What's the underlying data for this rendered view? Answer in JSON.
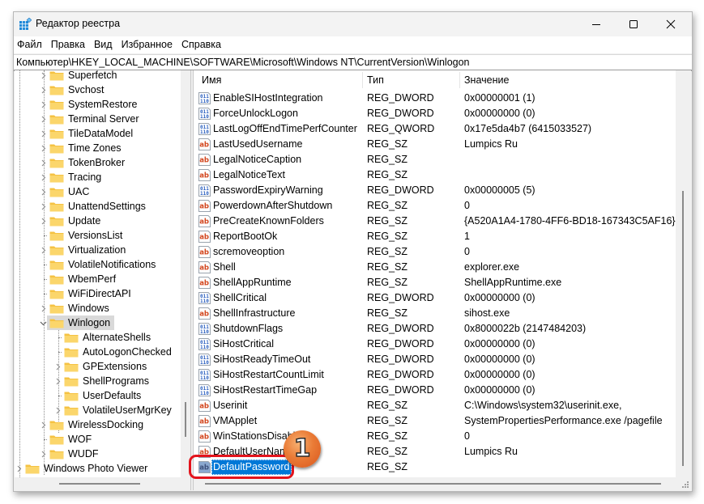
{
  "window": {
    "title": "Редактор реестра",
    "controls": {
      "minimize": "minimize",
      "maximize": "maximize",
      "close": "close"
    }
  },
  "menu": [
    "Файл",
    "Правка",
    "Вид",
    "Избранное",
    "Справка"
  ],
  "address": "Компьютер\\HKEY_LOCAL_MACHINE\\SOFTWARE\\Microsoft\\Windows NT\\CurrentVersion\\Winlogon",
  "tree": {
    "items": [
      {
        "label": "Superfetch",
        "level": 1,
        "expandable": true
      },
      {
        "label": "Svchost",
        "level": 1,
        "expandable": true
      },
      {
        "label": "SystemRestore",
        "level": 1,
        "expandable": true
      },
      {
        "label": "Terminal Server",
        "level": 1,
        "expandable": true
      },
      {
        "label": "TileDataModel",
        "level": 1,
        "expandable": true
      },
      {
        "label": "Time Zones",
        "level": 1,
        "expandable": true
      },
      {
        "label": "TokenBroker",
        "level": 1,
        "expandable": true
      },
      {
        "label": "Tracing",
        "level": 1,
        "expandable": true
      },
      {
        "label": "UAC",
        "level": 1,
        "expandable": true
      },
      {
        "label": "UnattendSettings",
        "level": 1,
        "expandable": true
      },
      {
        "label": "Update",
        "level": 1,
        "expandable": true
      },
      {
        "label": "VersionsList",
        "level": 1,
        "expandable": false
      },
      {
        "label": "Virtualization",
        "level": 1,
        "expandable": true
      },
      {
        "label": "VolatileNotifications",
        "level": 1,
        "expandable": false
      },
      {
        "label": "WbemPerf",
        "level": 1,
        "expandable": false
      },
      {
        "label": "WiFiDirectAPI",
        "level": 1,
        "expandable": false
      },
      {
        "label": "Windows",
        "level": 1,
        "expandable": true
      },
      {
        "label": "Winlogon",
        "level": 1,
        "expandable": true,
        "expanded": true,
        "selected": true
      },
      {
        "label": "AlternateShells",
        "level": 2,
        "expandable": false
      },
      {
        "label": "AutoLogonChecked",
        "level": 2,
        "expandable": false
      },
      {
        "label": "GPExtensions",
        "level": 2,
        "expandable": true
      },
      {
        "label": "ShellPrograms",
        "level": 2,
        "expandable": true
      },
      {
        "label": "UserDefaults",
        "level": 2,
        "expandable": false
      },
      {
        "label": "VolatileUserMgrKey",
        "level": 2,
        "expandable": true
      },
      {
        "label": "WirelessDocking",
        "level": 1,
        "expandable": true
      },
      {
        "label": "WOF",
        "level": 1,
        "expandable": false
      },
      {
        "label": "WUDF",
        "level": 1,
        "expandable": true
      },
      {
        "label": "Windows Photo Viewer",
        "level": 0,
        "expandable": true
      }
    ]
  },
  "list": {
    "columns": {
      "name": "Имя",
      "type": "Тип",
      "value": "Значение"
    },
    "rows": [
      {
        "icon": "binary-value-icon",
        "name": "EnableSIHostIntegration",
        "type": "REG_DWORD",
        "value": "0x00000001 (1)"
      },
      {
        "icon": "binary-value-icon",
        "name": "ForceUnlockLogon",
        "type": "REG_DWORD",
        "value": "0x00000000 (0)"
      },
      {
        "icon": "binary-value-icon",
        "name": "LastLogOffEndTimePerfCounter",
        "type": "REG_QWORD",
        "value": "0x17e5da4b7 (6415033527)"
      },
      {
        "icon": "string-value-icon",
        "name": "LastUsedUsername",
        "type": "REG_SZ",
        "value": "Lumpics Ru"
      },
      {
        "icon": "string-value-icon",
        "name": "LegalNoticeCaption",
        "type": "REG_SZ",
        "value": ""
      },
      {
        "icon": "string-value-icon",
        "name": "LegalNoticeText",
        "type": "REG_SZ",
        "value": ""
      },
      {
        "icon": "binary-value-icon",
        "name": "PasswordExpiryWarning",
        "type": "REG_DWORD",
        "value": "0x00000005 (5)"
      },
      {
        "icon": "string-value-icon",
        "name": "PowerdownAfterShutdown",
        "type": "REG_SZ",
        "value": "0"
      },
      {
        "icon": "string-value-icon",
        "name": "PreCreateKnownFolders",
        "type": "REG_SZ",
        "value": "{A520A1A4-1780-4FF6-BD18-167343C5AF16}"
      },
      {
        "icon": "string-value-icon",
        "name": "ReportBootOk",
        "type": "REG_SZ",
        "value": "1"
      },
      {
        "icon": "string-value-icon",
        "name": "scremoveoption",
        "type": "REG_SZ",
        "value": "0"
      },
      {
        "icon": "string-value-icon",
        "name": "Shell",
        "type": "REG_SZ",
        "value": "explorer.exe"
      },
      {
        "icon": "string-value-icon",
        "name": "ShellAppRuntime",
        "type": "REG_SZ",
        "value": "ShellAppRuntime.exe"
      },
      {
        "icon": "binary-value-icon",
        "name": "ShellCritical",
        "type": "REG_DWORD",
        "value": "0x00000000 (0)"
      },
      {
        "icon": "string-value-icon",
        "name": "ShellInfrastructure",
        "type": "REG_SZ",
        "value": "sihost.exe"
      },
      {
        "icon": "binary-value-icon",
        "name": "ShutdownFlags",
        "type": "REG_DWORD",
        "value": "0x8000022b (2147484203)"
      },
      {
        "icon": "binary-value-icon",
        "name": "SiHostCritical",
        "type": "REG_DWORD",
        "value": "0x00000000 (0)"
      },
      {
        "icon": "binary-value-icon",
        "name": "SiHostReadyTimeOut",
        "type": "REG_DWORD",
        "value": "0x00000000 (0)"
      },
      {
        "icon": "binary-value-icon",
        "name": "SiHostRestartCountLimit",
        "type": "REG_DWORD",
        "value": "0x00000000 (0)"
      },
      {
        "icon": "binary-value-icon",
        "name": "SiHostRestartTimeGap",
        "type": "REG_DWORD",
        "value": "0x00000000 (0)"
      },
      {
        "icon": "string-value-icon",
        "name": "Userinit",
        "type": "REG_SZ",
        "value": "C:\\Windows\\system32\\userinit.exe,"
      },
      {
        "icon": "string-value-icon",
        "name": "VMApplet",
        "type": "REG_SZ",
        "value": "SystemPropertiesPerformance.exe /pagefile"
      },
      {
        "icon": "string-value-icon",
        "name": "WinStationsDisabled",
        "type": "REG_SZ",
        "value": "0"
      },
      {
        "icon": "string-value-icon",
        "name": "DefaultUserName",
        "type": "REG_SZ",
        "value": "Lumpics Ru"
      },
      {
        "icon": "string-value-icon",
        "name": "DefaultPassword",
        "type": "REG_SZ",
        "value": "",
        "selected": true
      }
    ]
  },
  "annotation": {
    "step_number": "1",
    "ring_color": "#e3141c",
    "badge_color": "#ea7b36"
  },
  "colors": {
    "selection": "#0078d7",
    "tree_selected": "#d9d9d9",
    "folder": "#f8c94b"
  }
}
